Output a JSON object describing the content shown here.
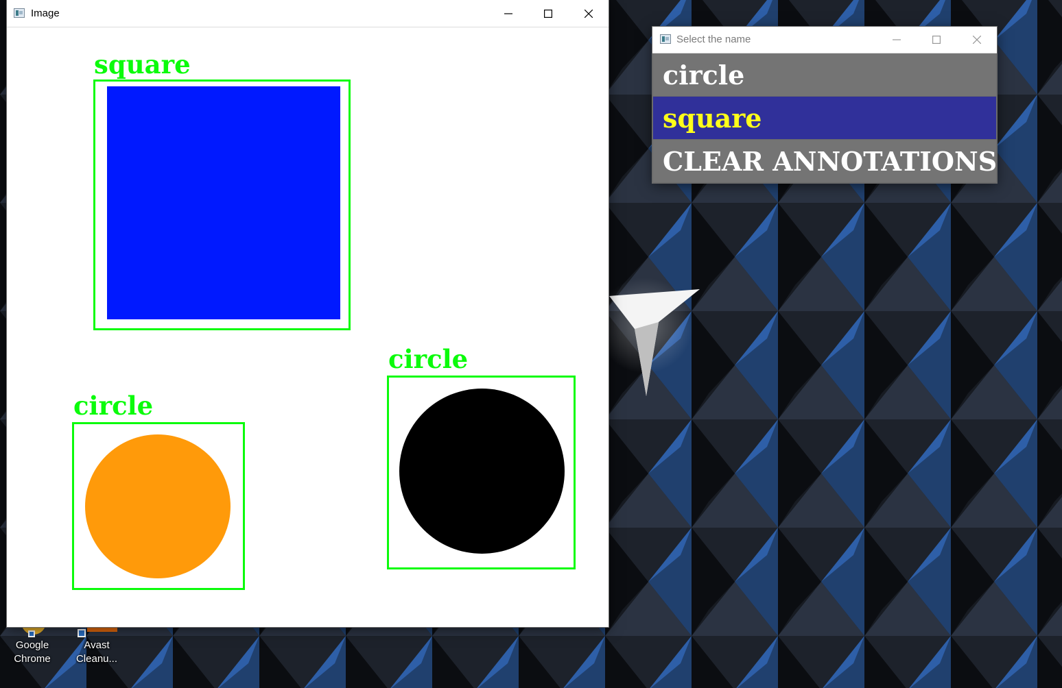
{
  "image_window": {
    "title": "Image",
    "controls": {
      "minimize": "minimize",
      "maximize": "maximize",
      "close": "close"
    },
    "annotations": [
      {
        "label": "square",
        "shape": "square",
        "fill": "#0019ff"
      },
      {
        "label": "circle",
        "shape": "circle",
        "fill": "#ff9a0a"
      },
      {
        "label": "circle",
        "shape": "circle",
        "fill": "#000000"
      }
    ],
    "annotation_color": "#0bfb0b"
  },
  "select_window": {
    "title": "Select the name",
    "options": [
      {
        "label": "circle",
        "selected": false
      },
      {
        "label": "square",
        "selected": true
      },
      {
        "label": "CLEAR  ANNOTATIONS",
        "selected": false
      }
    ],
    "selected_bg": "#30309a",
    "selected_fg": "#ffff1a"
  },
  "desktop_icons": [
    {
      "line1": "Google",
      "line2": "Chrome",
      "icon": "chrome-icon"
    },
    {
      "line1": "Avast",
      "line2": "Cleanu...",
      "icon": "avast-cleanup-icon"
    }
  ]
}
